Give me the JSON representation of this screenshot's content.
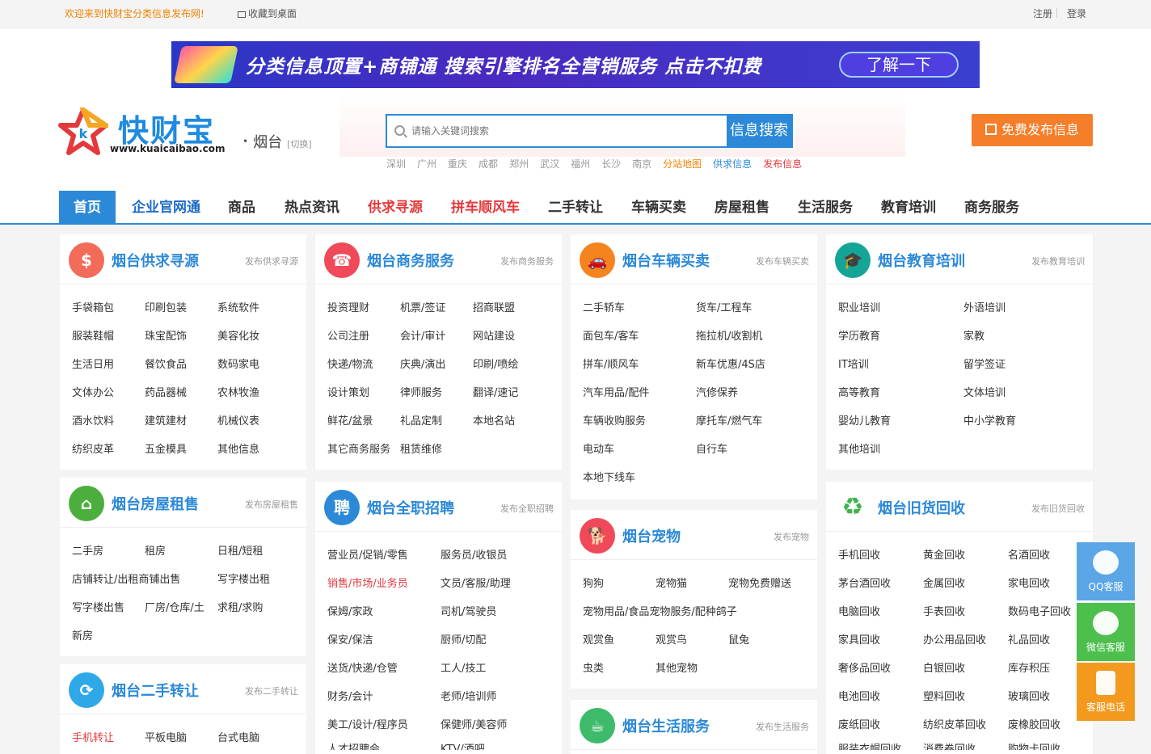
{
  "topbar": {
    "welcome": "欢迎来到快财宝分类信息发布网!",
    "favorite": "收藏到桌面",
    "register": "注册",
    "login": "登录"
  },
  "banner": {
    "text": "分类信息顶置+商铺通 搜索引擎排名全营销服务 点击不扣费",
    "button": "了解一下"
  },
  "logo": {
    "name": "快财宝",
    "url": "www.kuaicaibao.com"
  },
  "city": {
    "name": "烟台",
    "switch": "[切换]"
  },
  "search": {
    "placeholder": "请输入关键词搜索",
    "button": "信息搜索"
  },
  "hotcities": [
    "深圳",
    "广州",
    "重庆",
    "成都",
    "郑州",
    "武汉",
    "福州",
    "长沙",
    "南京"
  ],
  "hotlinks": {
    "sitemap": "分站地图",
    "supply": "供求信息",
    "post": "发布信息"
  },
  "publish_label": "免费发布信息",
  "nav": [
    "首页",
    "企业官网通",
    "商品",
    "热点资讯",
    "供求寻源",
    "拼车顺风车",
    "二手转让",
    "车辆买卖",
    "房屋租售",
    "生活服务",
    "教育培训",
    "商务服务"
  ],
  "cards": {
    "supply": {
      "title": "烟台供求寻源",
      "pub": "发布供求寻源",
      "items": [
        "手袋箱包",
        "印刷包装",
        "系统软件",
        "服装鞋帽",
        "珠宝配饰",
        "美容化妆",
        "生活日用",
        "餐饮食品",
        "数码家电",
        "文体办公",
        "药品器械",
        "农林牧渔",
        "酒水饮料",
        "建筑建材",
        "机械仪表",
        "纺织皮革",
        "五金模具",
        "其他信息"
      ]
    },
    "business": {
      "title": "烟台商务服务",
      "pub": "发布商务服务",
      "items": [
        "投资理财",
        "机票/签证",
        "招商联盟",
        "公司注册",
        "会计/审计",
        "网站建设",
        "快递/物流",
        "庆典/演出",
        "印刷/喷绘",
        "设计策划",
        "律师服务",
        "翻译/速记",
        "鲜花/盆景",
        "礼品定制",
        "本地名站",
        "其它商务服务",
        "租赁维修"
      ]
    },
    "vehicle": {
      "title": "烟台车辆买卖",
      "pub": "发布车辆买卖",
      "items": [
        "二手轿车",
        "货车/工程车",
        "面包车/客车",
        "拖拉机/收割机",
        "拼车/顺风车",
        "新车优惠/4S店",
        "汽车用品/配件",
        "汽修保养",
        "车辆收购服务",
        "摩托车/燃气车",
        "电动车",
        "自行车",
        "本地下线车"
      ]
    },
    "education": {
      "title": "烟台教育培训",
      "pub": "发布教育培训",
      "items": [
        "职业培训",
        "外语培训",
        "学历教育",
        "家教",
        "IT培训",
        "留学签证",
        "高等教育",
        "文体培训",
        "婴幼儿教育",
        "中小学教育",
        "其他培训"
      ]
    },
    "house": {
      "title": "烟台房屋租售",
      "pub": "发布房屋租售",
      "items": [
        "二手房",
        "租房",
        "日租/短租",
        "店铺转让/出租商铺出售",
        "写字楼出租",
        "写字楼出售",
        "厂房/仓库/土",
        "求租/求购",
        "新房"
      ]
    },
    "jobs": {
      "title": "烟台全职招聘",
      "pub": "发布全职招聘",
      "items": [
        "营业员/促销/零售",
        "服务员/收银员",
        "销售/市场/业务员",
        "文员/客服/助理",
        "保姆/家政",
        "司机/驾驶员",
        "保安/保洁",
        "厨师/切配",
        "送货/快递/仓管",
        "工人/技工",
        "财务/会计",
        "老师/培训师",
        "美工/设计/程序员",
        "保健师/美容师",
        "人才招聘会",
        "KTV/酒吧"
      ]
    },
    "pets": {
      "title": "烟台宠物",
      "pub": "发布宠物",
      "items": [
        "狗狗",
        "宠物猫",
        "宠物免费赠送",
        "宠物用品/食品宠物服务/配种鸽子",
        "观赏鱼",
        "观赏鸟",
        "鼠兔",
        "虫类",
        "其他宠物"
      ]
    },
    "recycle": {
      "title": "烟台旧货回收",
      "pub": "发布旧货回收",
      "items": [
        "手机回收",
        "黄金回收",
        "名酒回收",
        "茅台酒回收",
        "金属回收",
        "家电回收",
        "电脑回收",
        "手表回收",
        "数码电子回收",
        "家具回收",
        "办公用品回收",
        "礼品回收",
        "奢侈品回收",
        "白银回收",
        "库存积压",
        "电池回收",
        "塑料回收",
        "玻璃回收",
        "废纸回收",
        "纺织皮革回收",
        "废橡胶回收",
        "服装衣帽回收",
        "消费卷回收",
        "购物卡回收"
      ]
    },
    "secondhand": {
      "title": "烟台二手转让",
      "pub": "发布二手转让",
      "items": [
        "手机转让",
        "平板电脑",
        "台式电脑"
      ]
    },
    "life": {
      "title": "烟台生活服务",
      "pub": "发布生活服务"
    }
  },
  "float": {
    "qq": "QQ客服",
    "wechat": "微信客服",
    "phone": "客服电话"
  },
  "colors": {
    "accent": "#2c89d8",
    "orange": "#f57e2a",
    "red": "#e4393c"
  }
}
